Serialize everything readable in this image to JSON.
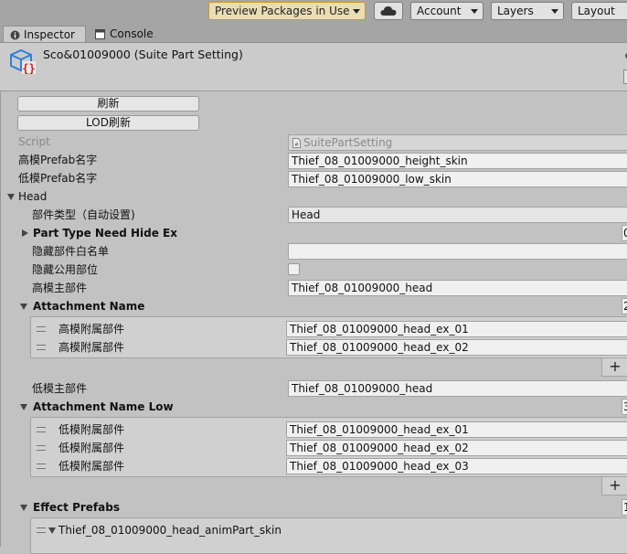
{
  "toolbar": {
    "preview_packages": "Preview Packages in Use",
    "account": "Account",
    "layers": "Layers",
    "layout": "Layout"
  },
  "tabs": {
    "inspector": "Inspector",
    "console": "Console"
  },
  "header": {
    "object_title": "Sco&01009000 (Suite Part Setting)"
  },
  "buttons": {
    "refresh": "刷新",
    "lod_refresh": "LOD刷新"
  },
  "fields": {
    "script_label": "Script",
    "script_value": "SuitePartSetting",
    "high_prefab_label": "高模Prefab名字",
    "high_prefab_value": "Thief_08_01009000_height_skin",
    "low_prefab_label": "低模Prefab名字",
    "low_prefab_value": "Thief_08_01009000_low_skin"
  },
  "head": {
    "label": "Head",
    "part_type_label": "部件类型（自动设置)",
    "part_type_value": "Head",
    "part_type_need_hide_label": "Part Type Need Hide Ex",
    "part_type_need_hide_count": "0",
    "hide_whitelist_label": "隐藏部件白名单",
    "hide_whitelist_value": "",
    "hide_public_label": "隐藏公用部位",
    "high_main_label": "高模主部件",
    "high_main_value": "Thief_08_01009000_head",
    "attachment_name_label": "Attachment Name",
    "attachment_name_count": "2",
    "attachment_items": [
      {
        "label": "高模附属部件",
        "value": "Thief_08_01009000_head_ex_01"
      },
      {
        "label": "高模附属部件",
        "value": "Thief_08_01009000_head_ex_02"
      }
    ],
    "plus_label": "+",
    "low_main_label": "低模主部件",
    "low_main_value": "Thief_08_01009000_head",
    "attachment_low_label": "Attachment Name Low",
    "attachment_low_count": "3",
    "attachment_low_items": [
      {
        "label": "低模附属部件",
        "value": "Thief_08_01009000_head_ex_01"
      },
      {
        "label": "低模附属部件",
        "value": "Thief_08_01009000_head_ex_02"
      },
      {
        "label": "低模附属部件",
        "value": "Thief_08_01009000_head_ex_03"
      }
    ],
    "effect_prefabs_label": "Effect Prefabs",
    "effect_prefabs_count": "1",
    "effect_item_label": "Thief_08_01009000_head_animPart_skin"
  }
}
